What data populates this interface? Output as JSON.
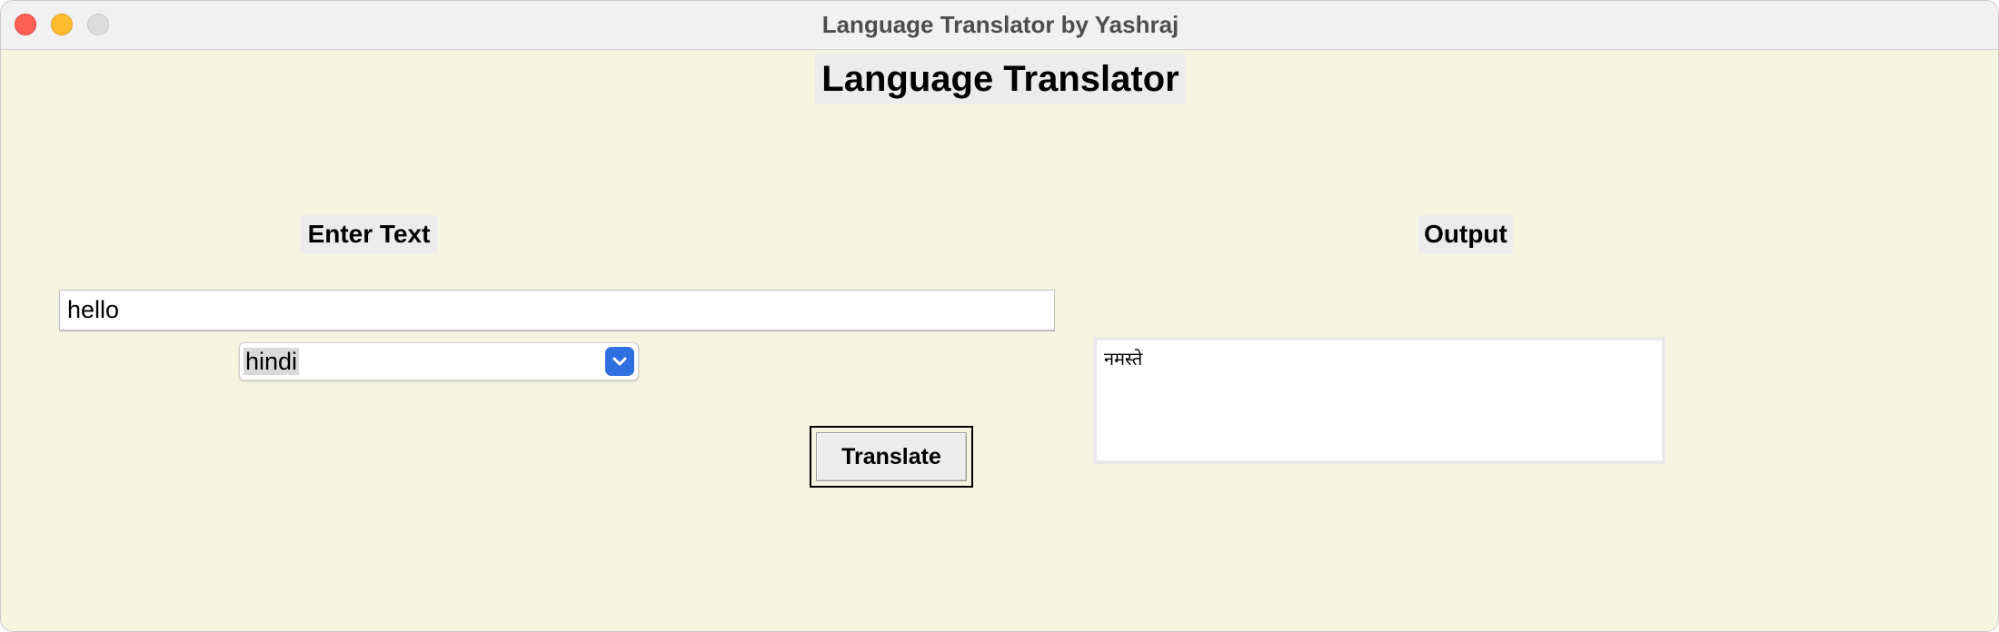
{
  "window": {
    "title": "Language Translator by Yashraj"
  },
  "app": {
    "heading": "Language Translator",
    "input_label": "Enter Text",
    "output_label": "Output",
    "input_value": "hello",
    "language_selected": "hindi",
    "translate_label": "Translate",
    "output_text": "नमस्ते"
  },
  "icons": {
    "window_close": "close-icon",
    "window_minimize": "minimize-icon",
    "window_maximize": "maximize-icon",
    "dropdown": "chevron-down-icon"
  },
  "colors": {
    "background": "#f5f4e0",
    "dropdown_accent": "#2f6fdf"
  }
}
